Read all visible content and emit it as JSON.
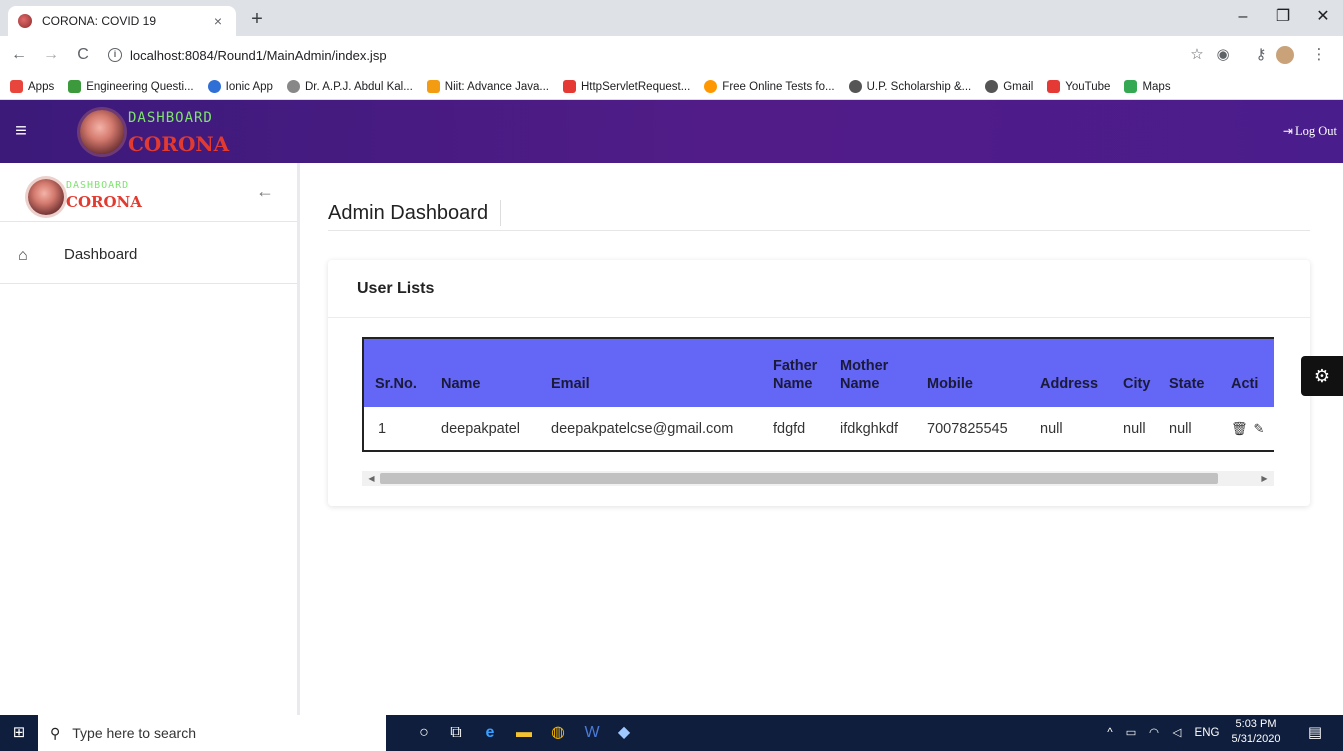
{
  "browser": {
    "tab_title": "CORONA: COVID 19",
    "tab_close": "×",
    "new_tab": "+",
    "url": "localhost:8084/Round1/MainAdmin/index.jsp",
    "win_min": "–",
    "win_max": "❐",
    "win_close": "✕",
    "bookmarks": [
      {
        "label": "Apps",
        "color": "#e8453c"
      },
      {
        "label": "Engineering Questi...",
        "color": "#3c9a3c"
      },
      {
        "label": "Ionic App",
        "color": "#2f6fd6"
      },
      {
        "label": "Dr. A.P.J. Abdul Kal...",
        "color": "#888888"
      },
      {
        "label": "Niit: Advance Java...",
        "color": "#f39c12"
      },
      {
        "label": "HttpServletRequest...",
        "color": "#e53935"
      },
      {
        "label": "Free Online Tests fo...",
        "color": "#ff9800"
      },
      {
        "label": "U.P. Scholarship &...",
        "color": "#555555"
      },
      {
        "label": "Gmail",
        "color": "#555555"
      },
      {
        "label": "YouTube",
        "color": "#e53935"
      },
      {
        "label": "Maps",
        "color": "#34a853"
      }
    ]
  },
  "header": {
    "logo_top": "DASHBOARD",
    "logo_bottom": "CORONA",
    "logout_label": "Log Out"
  },
  "sidebar": {
    "logo_top": "DASHBOARD",
    "logo_bottom": "CORONA",
    "items": [
      {
        "label": "Dashboard"
      }
    ]
  },
  "main": {
    "page_title": "Admin Dashboard",
    "card_title": "User Lists"
  },
  "table": {
    "headers": [
      "Sr.No.",
      "Name",
      "Email",
      "Father Name",
      "Mother Name",
      "Mobile",
      "Address",
      "City",
      "State",
      "Acti"
    ],
    "rows": [
      [
        "1",
        "deepakpatel",
        "deepakpatelcse@gmail.com",
        "fdgfd",
        "ifdkghkdf",
        "7007825545",
        "null",
        "null",
        "null"
      ]
    ]
  },
  "taskbar": {
    "search_placeholder": "Type here to search",
    "lang": "ENG",
    "time": "5:03 PM",
    "date": "5/31/2020"
  },
  "colors": {
    "header_gradient": "#521c88",
    "table_header": "#6466f6",
    "logo_green": "#7ee36e",
    "logo_red": "#e23a2f"
  }
}
